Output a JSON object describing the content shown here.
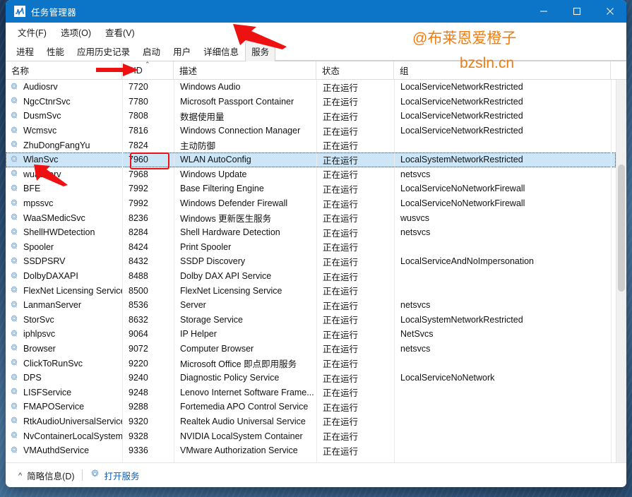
{
  "window": {
    "title": "任务管理器",
    "app_icon": "task-manager-icon",
    "controls": {
      "minimize": "−",
      "maximize": "□",
      "close": "✕"
    }
  },
  "menubar": {
    "items": [
      {
        "label": "文件(F)"
      },
      {
        "label": "选项(O)"
      },
      {
        "label": "查看(V)"
      }
    ]
  },
  "tabs": [
    {
      "label": "进程",
      "active": false
    },
    {
      "label": "性能",
      "active": false
    },
    {
      "label": "应用历史记录",
      "active": false
    },
    {
      "label": "启动",
      "active": false
    },
    {
      "label": "用户",
      "active": false
    },
    {
      "label": "详细信息",
      "active": false
    },
    {
      "label": "服务",
      "active": true
    }
  ],
  "table": {
    "columns": [
      {
        "key": "name",
        "label": "名称",
        "sorted": false
      },
      {
        "key": "pid",
        "label": "PID",
        "sorted": true,
        "sort_dir": "asc",
        "caret": "⌃"
      },
      {
        "key": "desc",
        "label": "描述",
        "sorted": false
      },
      {
        "key": "status",
        "label": "状态",
        "sorted": false
      },
      {
        "key": "group",
        "label": "组",
        "sorted": false
      }
    ],
    "rows": [
      {
        "name": "Audiosrv",
        "pid": "7720",
        "desc": "Windows Audio",
        "status": "正在运行",
        "group": "LocalServiceNetworkRestricted",
        "selected": false
      },
      {
        "name": "NgcCtnrSvc",
        "pid": "7780",
        "desc": "Microsoft Passport Container",
        "status": "正在运行",
        "group": "LocalServiceNetworkRestricted",
        "selected": false
      },
      {
        "name": "DusmSvc",
        "pid": "7808",
        "desc": "数据使用量",
        "status": "正在运行",
        "group": "LocalServiceNetworkRestricted",
        "selected": false
      },
      {
        "name": "Wcmsvc",
        "pid": "7816",
        "desc": "Windows Connection Manager",
        "status": "正在运行",
        "group": "LocalServiceNetworkRestricted",
        "selected": false
      },
      {
        "name": "ZhuDongFangYu",
        "pid": "7824",
        "desc": "主动防御",
        "status": "正在运行",
        "group": "",
        "selected": false
      },
      {
        "name": "WlanSvc",
        "pid": "7960",
        "desc": "WLAN AutoConfig",
        "status": "正在运行",
        "group": "LocalSystemNetworkRestricted",
        "selected": true
      },
      {
        "name": "wuauserv",
        "pid": "7968",
        "desc": "Windows Update",
        "status": "正在运行",
        "group": "netsvcs",
        "selected": false
      },
      {
        "name": "BFE",
        "pid": "7992",
        "desc": "Base Filtering Engine",
        "status": "正在运行",
        "group": "LocalServiceNoNetworkFirewall",
        "selected": false
      },
      {
        "name": "mpssvc",
        "pid": "7992",
        "desc": "Windows Defender Firewall",
        "status": "正在运行",
        "group": "LocalServiceNoNetworkFirewall",
        "selected": false
      },
      {
        "name": "WaaSMedicSvc",
        "pid": "8236",
        "desc": "Windows 更新医生服务",
        "status": "正在运行",
        "group": "wusvcs",
        "selected": false
      },
      {
        "name": "ShellHWDetection",
        "pid": "8284",
        "desc": "Shell Hardware Detection",
        "status": "正在运行",
        "group": "netsvcs",
        "selected": false
      },
      {
        "name": "Spooler",
        "pid": "8424",
        "desc": "Print Spooler",
        "status": "正在运行",
        "group": "",
        "selected": false
      },
      {
        "name": "SSDPSRV",
        "pid": "8432",
        "desc": "SSDP Discovery",
        "status": "正在运行",
        "group": "LocalServiceAndNoImpersonation",
        "selected": false
      },
      {
        "name": "DolbyDAXAPI",
        "pid": "8488",
        "desc": "Dolby DAX API Service",
        "status": "正在运行",
        "group": "",
        "selected": false
      },
      {
        "name": "FlexNet Licensing Service",
        "pid": "8500",
        "desc": "FlexNet Licensing Service",
        "status": "正在运行",
        "group": "",
        "selected": false
      },
      {
        "name": "LanmanServer",
        "pid": "8536",
        "desc": "Server",
        "status": "正在运行",
        "group": "netsvcs",
        "selected": false
      },
      {
        "name": "StorSvc",
        "pid": "8632",
        "desc": "Storage Service",
        "status": "正在运行",
        "group": "LocalSystemNetworkRestricted",
        "selected": false
      },
      {
        "name": "iphlpsvc",
        "pid": "9064",
        "desc": "IP Helper",
        "status": "正在运行",
        "group": "NetSvcs",
        "selected": false
      },
      {
        "name": "Browser",
        "pid": "9072",
        "desc": "Computer Browser",
        "status": "正在运行",
        "group": "netsvcs",
        "selected": false
      },
      {
        "name": "ClickToRunSvc",
        "pid": "9220",
        "desc": "Microsoft Office 即点即用服务",
        "status": "正在运行",
        "group": "",
        "selected": false
      },
      {
        "name": "DPS",
        "pid": "9240",
        "desc": "Diagnostic Policy Service",
        "status": "正在运行",
        "group": "LocalServiceNoNetwork",
        "selected": false
      },
      {
        "name": "LISFService",
        "pid": "9248",
        "desc": "Lenovo Internet Software Frame...",
        "status": "正在运行",
        "group": "",
        "selected": false
      },
      {
        "name": "FMAPOService",
        "pid": "9288",
        "desc": "Fortemedia APO Control Service",
        "status": "正在运行",
        "group": "",
        "selected": false
      },
      {
        "name": "RtkAudioUniversalService",
        "pid": "9320",
        "desc": "Realtek Audio Universal Service",
        "status": "正在运行",
        "group": "",
        "selected": false
      },
      {
        "name": "NvContainerLocalSystem",
        "pid": "9328",
        "desc": "NVIDIA LocalSystem Container",
        "status": "正在运行",
        "group": "",
        "selected": false
      },
      {
        "name": "VMAuthdService",
        "pid": "9336",
        "desc": "VMware Authorization Service",
        "status": "正在运行",
        "group": "",
        "selected": false
      }
    ]
  },
  "statusbar": {
    "fewer_details": "简略信息(D)",
    "open_services": "打开服务"
  },
  "annotations": {
    "watermark_handle": "@布莱恩爱橙子",
    "watermark_site": "bzsln.cn",
    "watermark_color": "#f07c10",
    "highlight_color": "#ee1111",
    "arrow_color": "#ee1111"
  }
}
